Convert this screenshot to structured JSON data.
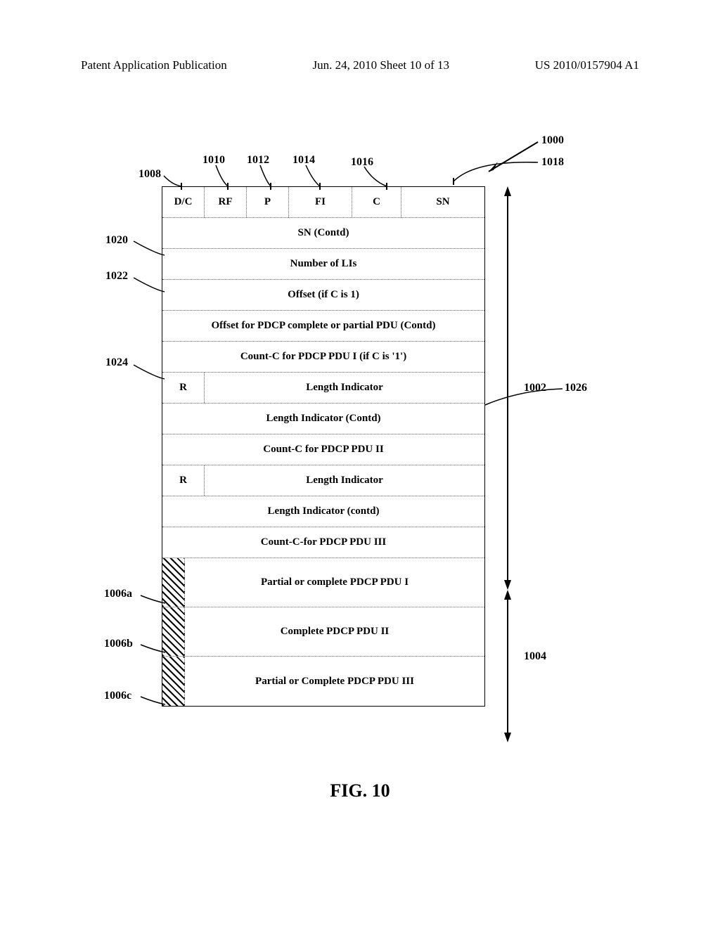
{
  "header": {
    "left": "Patent Application Publication",
    "center": "Jun. 24, 2010  Sheet 10 of 13",
    "right": "US 2010/0157904 A1"
  },
  "figure_caption": "FIG. 10",
  "labels": {
    "l1000": "1000",
    "l1002": "1002",
    "l1004": "1004",
    "l1006a": "1006a",
    "l1006b": "1006b",
    "l1006c": "1006c",
    "l1008": "1008",
    "l1010": "1010",
    "l1012": "1012",
    "l1014": "1014",
    "l1016": "1016",
    "l1018": "1018",
    "l1020": "1020",
    "l1022": "1022",
    "l1024": "1024",
    "l1026": "1026"
  },
  "cells": {
    "dc": "D/C",
    "rf": "RF",
    "p": "P",
    "fi": "FI",
    "c": "C",
    "sn": "SN",
    "sn_contd": "SN (Contd)",
    "num_li": "Number of LIs",
    "offset": "Offset (if C is 1)",
    "offset_contd": "Offset for PDCP complete or partial PDU (Contd)",
    "countc1": "Count-C for PDCP PDU I (if C is '1')",
    "r": "R",
    "len_ind": "Length Indicator",
    "len_ind_contd": "Length Indicator (Contd)",
    "countc2": "Count-C for PDCP PDU II",
    "len_ind2_contd": "Length Indicator (contd)",
    "countc3": "Count-C-for PDCP PDU III",
    "pdu1": "Partial or complete PDCP PDU I",
    "pdu2": "Complete PDCP PDU II",
    "pdu3": "Partial or Complete PDCP PDU III"
  }
}
